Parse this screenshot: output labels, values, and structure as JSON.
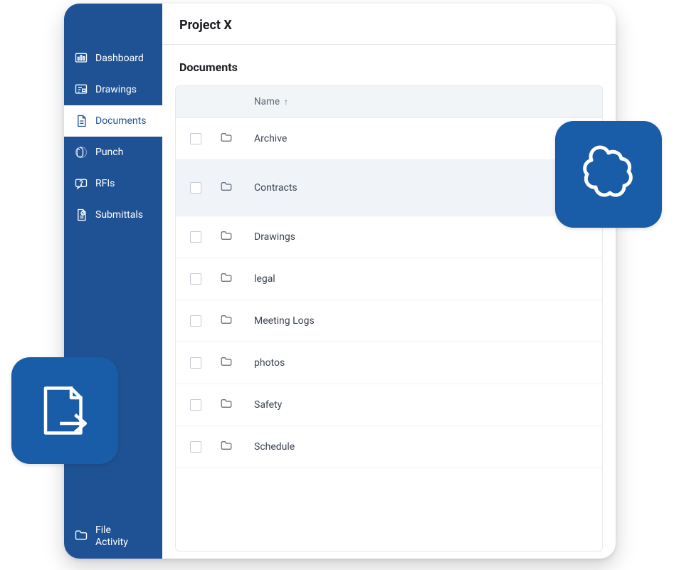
{
  "header": {
    "title": "Project X"
  },
  "page": {
    "section_title": "Documents"
  },
  "table": {
    "columns": {
      "name": "Name"
    },
    "sort_indicator": "↑",
    "rows": [
      {
        "name": "Archive",
        "highlight": false
      },
      {
        "name": "Contracts",
        "highlight": true
      },
      {
        "name": "Drawings",
        "highlight": false
      },
      {
        "name": "legal",
        "highlight": false
      },
      {
        "name": "Meeting Logs",
        "highlight": false
      },
      {
        "name": "photos",
        "highlight": false
      },
      {
        "name": "Safety",
        "highlight": false
      },
      {
        "name": "Schedule",
        "highlight": false
      }
    ]
  },
  "sidebar": {
    "items": [
      {
        "label": "Dashboard",
        "icon": "dashboard-icon",
        "active": false
      },
      {
        "label": "Drawings",
        "icon": "drawings-icon",
        "active": false
      },
      {
        "label": "Documents",
        "icon": "document-icon",
        "active": true
      },
      {
        "label": "Punch",
        "icon": "punch-icon",
        "active": false
      },
      {
        "label": "RFIs",
        "icon": "rfi-icon",
        "active": false
      },
      {
        "label": "Submittals",
        "icon": "submittals-icon",
        "active": false
      }
    ],
    "bottom": {
      "label": "File\nActivity",
      "icon": "folder-icon"
    }
  }
}
